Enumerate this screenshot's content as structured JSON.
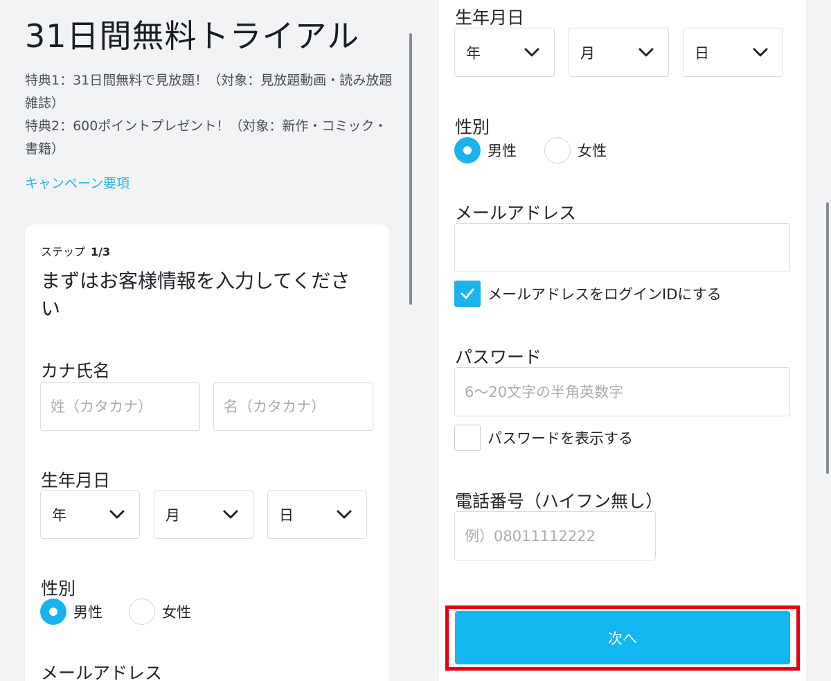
{
  "left": {
    "title": "31日間無料トライアル",
    "benefit1": "特典1：31日間無料で見放題！（対象：見放題動画・読み放題雑誌）",
    "benefit2": "特典2：600ポイントプレゼント！（対象：新作・コミック・書籍）",
    "campaign_link": "キャンペーン要項",
    "step_label": "ステップ",
    "step_value": "1/3",
    "heading": "まずはお客様情報を入力してください",
    "kana_label": "カナ氏名",
    "kana_last_placeholder": "姓（カタカナ）",
    "kana_first_placeholder": "名（カタカナ）",
    "birthday_label": "生年月日",
    "birthday": {
      "year": "年",
      "month": "月",
      "day": "日"
    },
    "gender_label": "性別",
    "gender_male": "男性",
    "gender_female": "女性",
    "email_label": "メールアドレス"
  },
  "right": {
    "birthday_label": "生年月日",
    "birthday": {
      "year": "年",
      "month": "月",
      "day": "日"
    },
    "gender_label": "性別",
    "gender_male": "男性",
    "gender_female": "女性",
    "email_label": "メールアドレス",
    "email_value": "",
    "email_as_login": "メールアドレスをログインIDにする",
    "password_label": "パスワード",
    "password_placeholder": "6〜20文字の半角英数字",
    "show_password": "パスワードを表示する",
    "phone_label": "電話番号（ハイフン無し）",
    "phone_placeholder": "例）08011112222",
    "next_button": "次へ"
  },
  "colors": {
    "accent": "#19b3ee",
    "highlight": "#e60012",
    "link": "#2fb3e0"
  }
}
